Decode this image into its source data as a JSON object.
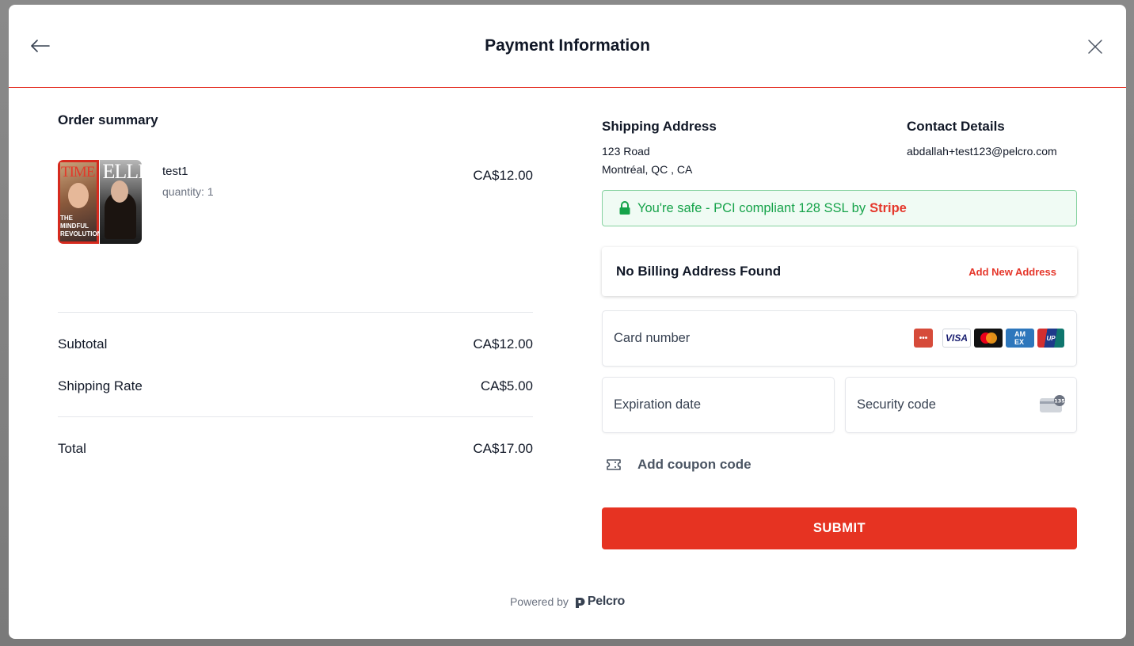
{
  "modal": {
    "title": "Payment Information"
  },
  "order": {
    "title": "Order summary",
    "item": {
      "name": "test1",
      "quantity": "quantity: 1",
      "price": "CA$12.00",
      "thumbnail": {
        "mag1_mast": "TIME",
        "mag1_caption": "THE MINDFUL REVOLUTION",
        "mag2_mast": "ELLE"
      }
    },
    "subtotal_label": "Subtotal",
    "subtotal_value": "CA$12.00",
    "shipping_label": "Shipping Rate",
    "shipping_value": "CA$5.00",
    "total_label": "Total",
    "total_value": "CA$17.00"
  },
  "shipping": {
    "title": "Shipping Address",
    "line1": "123 Road",
    "line2": "Montréal, QC , CA"
  },
  "contact": {
    "title": "Contact Details",
    "email": "abdallah+test123@pelcro.com"
  },
  "security": {
    "text": "You're safe - PCI compliant 128 SSL by",
    "brand": "Stripe"
  },
  "billing": {
    "status": "No Billing Address Found",
    "add_label": "Add New Address"
  },
  "payment": {
    "card_placeholder": "Card number",
    "exp_placeholder": "Expiration date",
    "cvc_placeholder": "Security code",
    "card_brands": [
      "generic-card-icon",
      "visa-icon",
      "mastercard-icon",
      "amex-icon",
      "unionpay-icon"
    ]
  },
  "coupon": {
    "label": "Add coupon code"
  },
  "submit": {
    "label": "SUBMIT"
  },
  "footer": {
    "powered_by": "Powered by",
    "brand": "Pelcro"
  },
  "colors": {
    "accent": "#e63322",
    "safe_text": "#16a34a",
    "safe_bg": "#f0fbf4"
  }
}
